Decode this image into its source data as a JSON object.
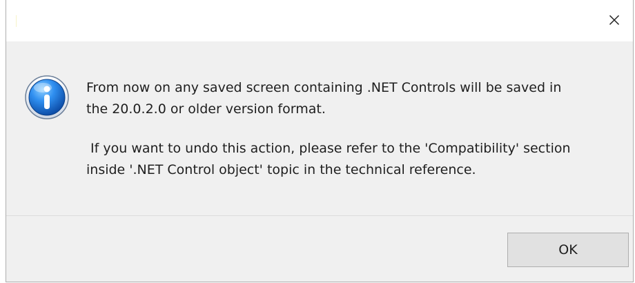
{
  "window": {
    "close_icon": "close-icon"
  },
  "message": {
    "icon": "info-icon",
    "line1": "From now on any saved screen containing .NET Controls will be saved in\nthe 20.0.2.0 or older version format.",
    "line2": " If you want to undo this action, please refer to the 'Compatibility' section\ninside '.NET Control object' topic in the technical reference."
  },
  "buttons": {
    "ok_label": "OK"
  },
  "colors": {
    "body_background": "#f0f0f0",
    "title_background": "#ffffff",
    "text": "#1e1e1e",
    "button_background": "#e1e1e1",
    "button_border": "#adadad",
    "info_icon_blue": "#1565c0"
  }
}
